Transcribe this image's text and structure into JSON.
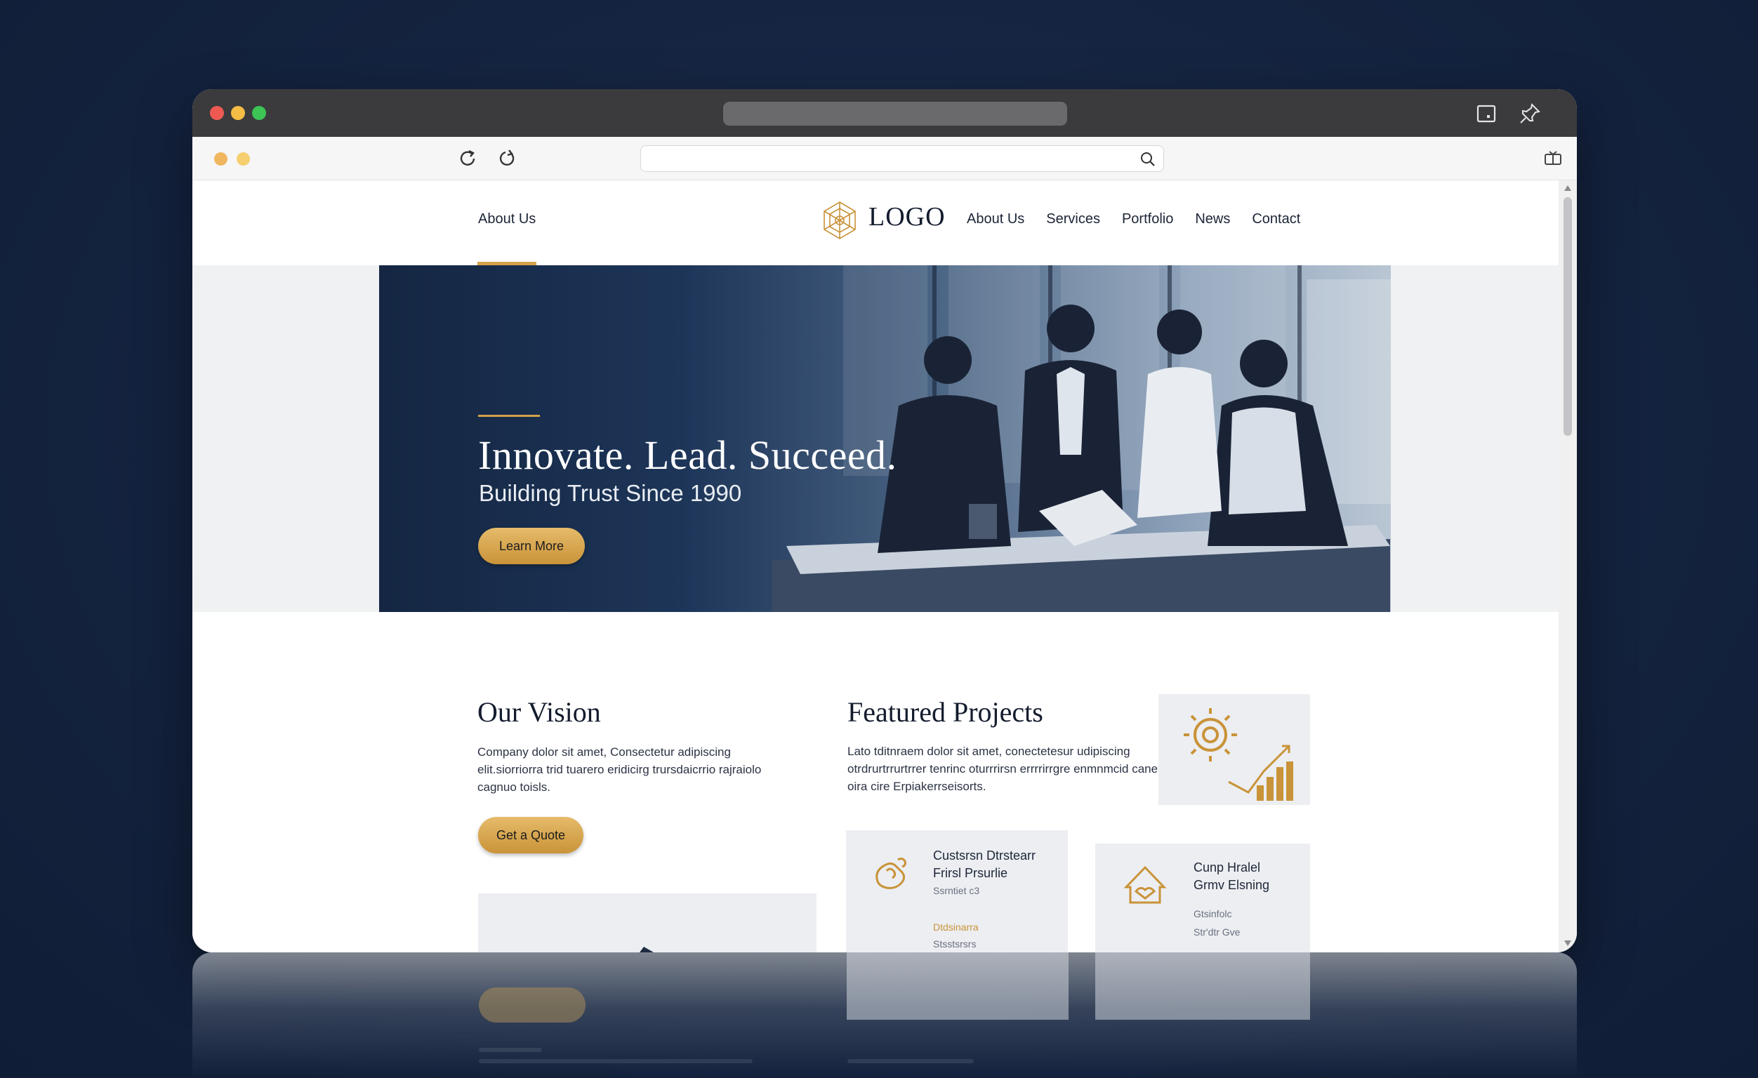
{
  "browser": {
    "traffic_lights": {
      "close": "#ee5a52",
      "minimize": "#f4bd45",
      "maximize": "#3cc455"
    },
    "toolbar_dots": [
      "#f0b660",
      "#f5cf70"
    ],
    "address_placeholder": "",
    "icons": [
      "sidebar-icon",
      "pin-icon",
      "reload-icon",
      "refresh-icon",
      "search-icon",
      "share-icon"
    ]
  },
  "nav": {
    "active_left_label": "About Us",
    "logo_text": "LOGO",
    "links": [
      "About Us",
      "Services",
      "Portfolio",
      "News",
      "Contact"
    ]
  },
  "hero": {
    "title": "Innovate. Lead. Succeed.",
    "subtitle": "Building Trust Since 1990",
    "cta_label": "Learn More"
  },
  "vision": {
    "title": "Our Vision",
    "body_lines": [
      "Company dolor sit amet, Consectetur adipiscing",
      "elit.siorriorra trid tuarero eridicirg trursdaicrrio rajraiolo",
      "cagnuo toisls."
    ],
    "cta_label": "Get a Quote"
  },
  "projects": {
    "title": "Featured Projects",
    "body_lines": [
      "Lato tditnraem dolor sit amet, conectetesur udipiscing",
      "otrdrurtrrurtrrer tenrinc oturrrirsn errrrirrgre enmnmcid cane",
      "oira cire Erpiakerrseisorts."
    ],
    "cards": [
      {
        "title_lines": [
          "Custsrsn Dtrstearr",
          "Frirsl Prsurlie"
        ],
        "meta": "Ssrntiet c3",
        "accent": "Dtdsinarra",
        "meta2": "Stsstsrsrs"
      },
      {
        "title_lines": [
          "Cunp Hralel",
          "Grmv Elsning"
        ],
        "meta": "Gtsinfolc",
        "meta2": "Str'dtr Gve"
      }
    ]
  },
  "colors": {
    "accent_gold": "#d4a24a",
    "navy": "#142642",
    "page_background": "#14233f"
  }
}
